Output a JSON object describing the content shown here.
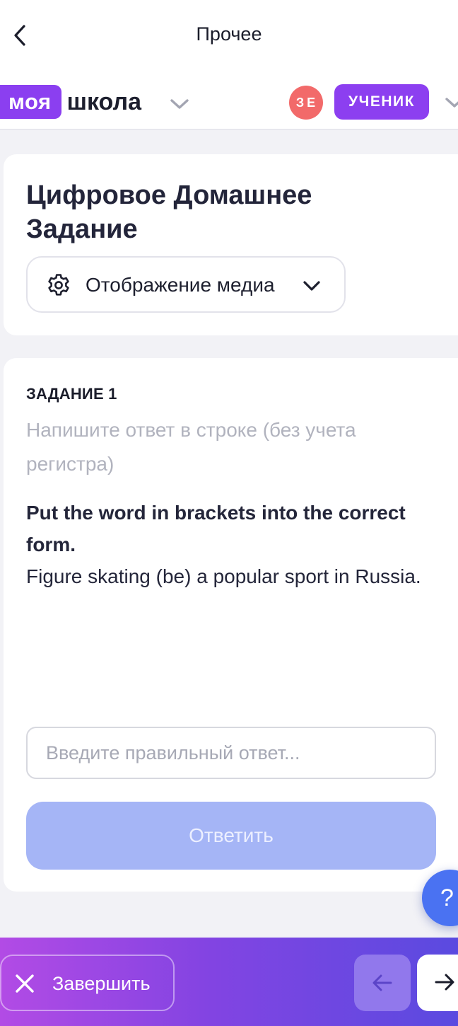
{
  "header": {
    "title": "Прочее",
    "back_icon": "chevron-left-icon"
  },
  "school": {
    "logo_part1": "моя",
    "logo_part2": "школа",
    "avatar_initials": "ЗЕ",
    "role": "УЧЕНИК",
    "colors": {
      "brand": "#8b3ff0",
      "avatar": "#f26a6a"
    }
  },
  "page": {
    "title": "Цифровое Домашнее Задание",
    "media_select": {
      "label": "Отображение медиа",
      "icon": "gear-icon"
    }
  },
  "task": {
    "number_label": "ЗАДАНИЕ 1",
    "hint": "Напишите ответ в строке (без учета регистра)",
    "instruction": "Put the word in brackets into the correct form.",
    "sentence": "Figure skating (be) a popular sport in Russia.",
    "answer_placeholder": "Введите правильный ответ...",
    "answer_value": "",
    "submit_label": "Ответить"
  },
  "help": {
    "label": "?"
  },
  "footer": {
    "finish_label": "Завершить",
    "prev_icon": "arrow-left-icon",
    "next_icon": "arrow-right-icon"
  }
}
